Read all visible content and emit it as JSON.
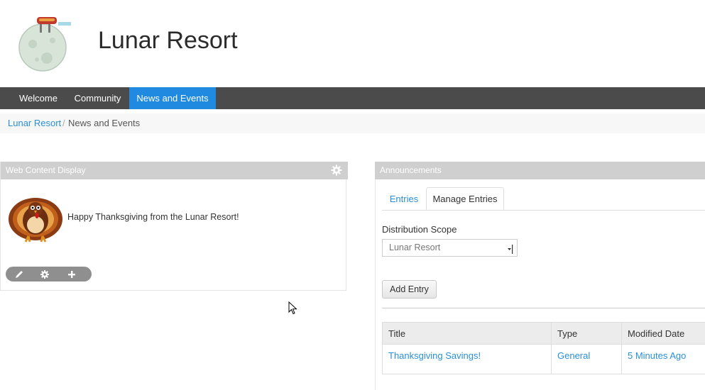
{
  "header": {
    "site_title": "Lunar Resort",
    "logo_icon": "moon-logo-icon"
  },
  "nav": {
    "items": [
      {
        "label": "Welcome",
        "active": false
      },
      {
        "label": "Community",
        "active": false
      },
      {
        "label": "News and Events",
        "active": true
      }
    ],
    "active_color": "#1f8ae0"
  },
  "breadcrumb": {
    "link": "Lunar Resort",
    "separator": "/",
    "current": "News and Events"
  },
  "web_content_display": {
    "title": "Web Content Display",
    "message": "Happy Thanksgiving from the Lunar Resort!",
    "image_icon": "turkey-icon",
    "toolbar_icons": [
      "pencil-icon",
      "gear-icon",
      "plus-icon"
    ]
  },
  "announcements": {
    "title": "Announcements",
    "tabs": [
      {
        "label": "Entries",
        "selected": false
      },
      {
        "label": "Manage Entries",
        "selected": true
      }
    ],
    "distribution_scope_label": "Distribution Scope",
    "distribution_scope_value": "Lunar Resort",
    "add_entry_label": "Add Entry",
    "table": {
      "headers": [
        "Title",
        "Type",
        "Modified Date"
      ],
      "rows": [
        [
          "Thanksgiving Savings!",
          "General",
          "5 Minutes Ago"
        ]
      ]
    }
  }
}
